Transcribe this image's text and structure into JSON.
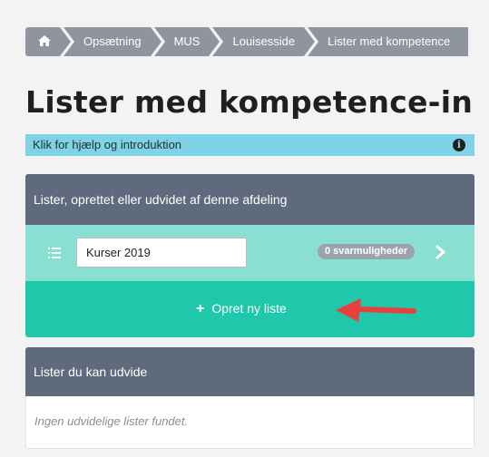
{
  "breadcrumb": {
    "home_icon": "home-icon",
    "items": [
      "Opsætning",
      "MUS",
      "Louisesside",
      "Lister med kompetence"
    ]
  },
  "page_title": "Lister med kompetence-in",
  "help": {
    "text": "Klik for hjælp og introduktion",
    "icon": "info-icon"
  },
  "own_lists": {
    "header": "Lister, oprettet eller udvidet af denne afdeling",
    "items": [
      {
        "name": "Kurser 2019",
        "badge": "0 svarmuligheder",
        "icon": "list-icon",
        "chevron": "chevron-right-icon"
      }
    ],
    "add_button": "Opret ny liste"
  },
  "extendable_lists": {
    "header": "Lister du kan udvide",
    "empty_text": "Ingen udvidelige lister fundet."
  },
  "colors": {
    "breadcrumb": "#8f959f",
    "help_bar": "#7fd3e6",
    "panel_header": "#5f6a7d",
    "list_row": "#89e0d2",
    "add_row": "#1fc8aa",
    "annotation_arrow": "#e8403c"
  }
}
